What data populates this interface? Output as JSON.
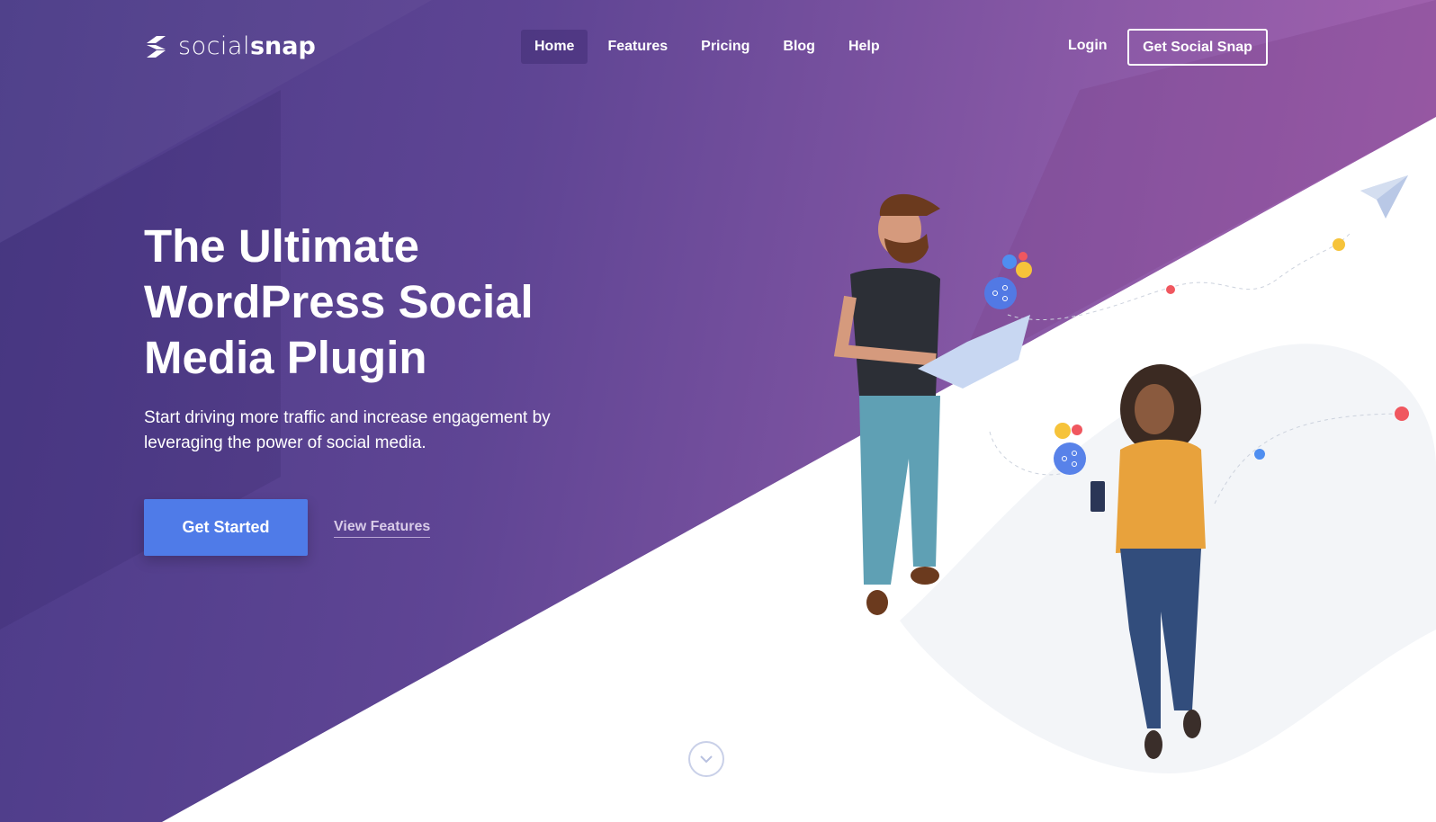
{
  "brand": {
    "name_light": "social",
    "name_bold": "snap"
  },
  "nav": {
    "items": [
      {
        "label": "Home",
        "active": true
      },
      {
        "label": "Features"
      },
      {
        "label": "Pricing"
      },
      {
        "label": "Blog"
      },
      {
        "label": "Help"
      }
    ],
    "login": "Login",
    "cta": "Get Social Snap"
  },
  "hero": {
    "title": "The Ultimate WordPress Social Media Plugin",
    "subtitle": "Start driving more traffic and increase engagement by leveraging the power of social media.",
    "primary_button": "Get Started",
    "secondary_link": "View Features"
  },
  "colors": {
    "accent": "#4f7be8",
    "gradient_start": "#4b3b88",
    "gradient_end": "#a864b0"
  },
  "icons": [
    "logo-icon",
    "share-icon",
    "paper-plane-icon",
    "chevron-down-icon"
  ]
}
